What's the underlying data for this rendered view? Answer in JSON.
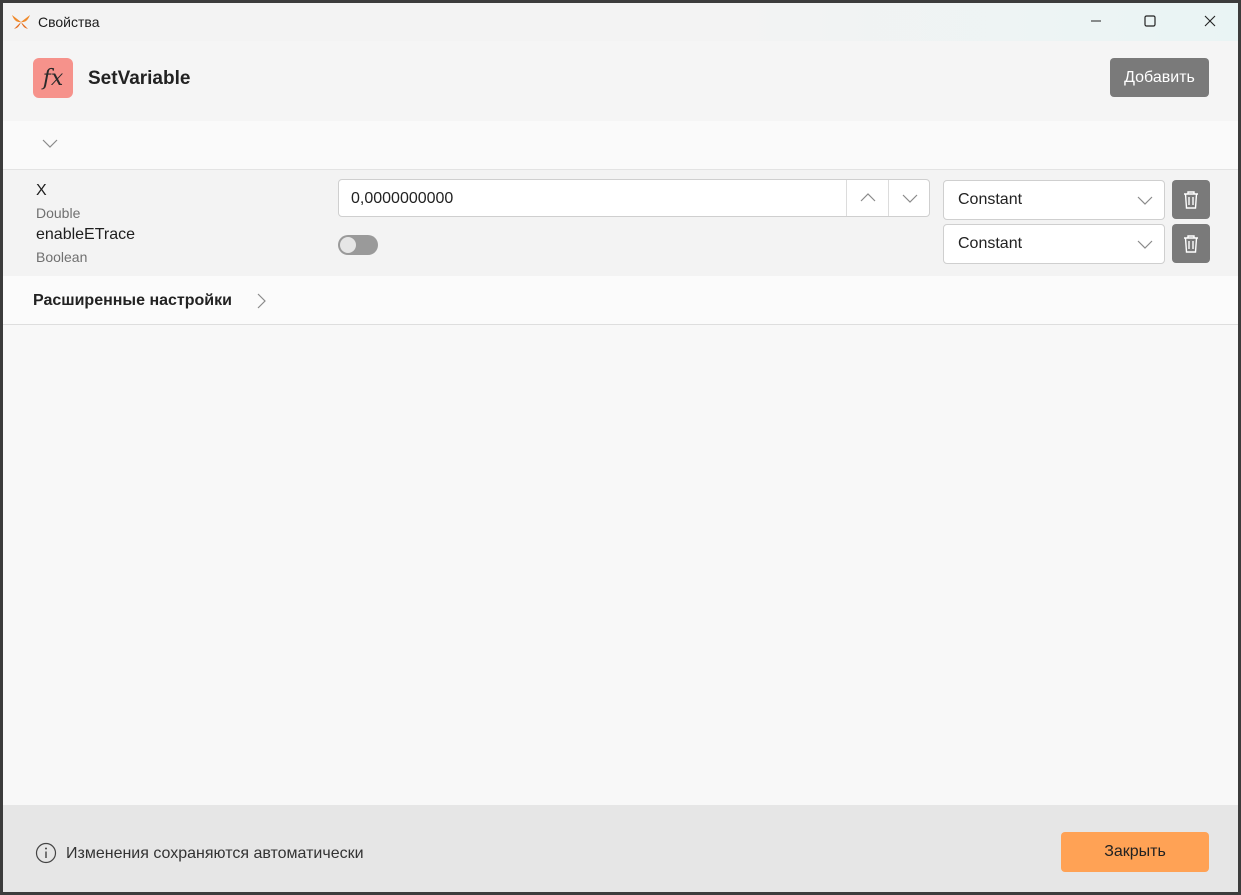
{
  "window": {
    "title": "Свойства",
    "controls": [
      "minimize",
      "maximize",
      "close"
    ]
  },
  "header": {
    "icon_label": "fx",
    "title": "SetVariable",
    "add_button": "Добавить",
    "accent_color": "#f6928b"
  },
  "parameters": [
    {
      "name": "X",
      "type": "Double",
      "value": "0,0000000000",
      "mode": "Constant"
    },
    {
      "name": "enableETrace",
      "type": "Boolean",
      "value": false,
      "mode": "Constant"
    }
  ],
  "advanced": {
    "label": "Расширенные настройки"
  },
  "footer": {
    "note": "Изменения сохраняются автоматически",
    "close_button": "Закрыть",
    "close_color": "#ffa255"
  },
  "icons": [
    "app-logo-icon",
    "minimize-icon",
    "maximize-icon",
    "close-icon",
    "chevron-down-icon",
    "chevron-up-icon",
    "trash-icon",
    "chevron-right-icon",
    "info-icon"
  ]
}
